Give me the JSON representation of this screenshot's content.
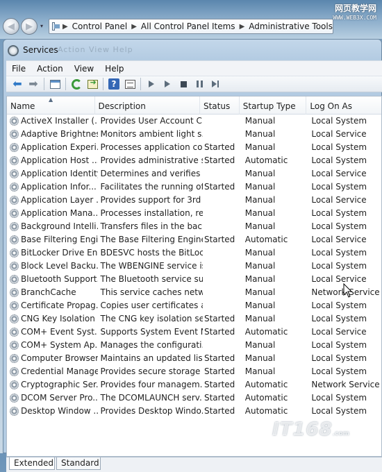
{
  "watermark": {
    "line1": "网页教学网",
    "line2": "WWW.WEB3X.COM",
    "bottom": "IT168",
    "bottom_small": ".com"
  },
  "address": {
    "crumbs": [
      "Control Panel",
      "All Control Panel Items",
      "Administrative Tools"
    ]
  },
  "window": {
    "title": "Services",
    "ghost_menu": "Action  View  Help"
  },
  "menu": [
    "File",
    "Action",
    "View",
    "Help"
  ],
  "toolbar_icons": [
    "back-arrow-icon",
    "forward-arrow-icon",
    "show-hide-tree-icon",
    "refresh-icon",
    "export-list-icon",
    "help-icon",
    "properties-icon",
    "start-service-icon",
    "start-service-alt-icon",
    "stop-service-icon",
    "pause-service-icon",
    "restart-service-icon"
  ],
  "columns": {
    "name": "Name",
    "description": "Description",
    "status": "Status",
    "startup": "Startup Type",
    "logon": "Log On As"
  },
  "services": [
    {
      "name": "ActiveX Installer (...",
      "description": "Provides User Account C...",
      "status": "",
      "startup": "Manual",
      "logon": "Local System"
    },
    {
      "name": "Adaptive Brightness",
      "description": "Monitors ambient light s...",
      "status": "",
      "startup": "Manual",
      "logon": "Local Service"
    },
    {
      "name": "Application Experi...",
      "description": "Processes application co...",
      "status": "Started",
      "startup": "Manual",
      "logon": "Local System"
    },
    {
      "name": "Application Host ...",
      "description": "Provides administrative s...",
      "status": "Started",
      "startup": "Automatic",
      "logon": "Local System"
    },
    {
      "name": "Application Identity",
      "description": "Determines and verifies t...",
      "status": "",
      "startup": "Manual",
      "logon": "Local Service"
    },
    {
      "name": "Application Infor...",
      "description": "Facilitates the running of...",
      "status": "Started",
      "startup": "Manual",
      "logon": "Local System"
    },
    {
      "name": "Application Layer ...",
      "description": "Provides support for 3rd ...",
      "status": "",
      "startup": "Manual",
      "logon": "Local Service"
    },
    {
      "name": "Application Mana...",
      "description": "Processes installation, re...",
      "status": "",
      "startup": "Manual",
      "logon": "Local System"
    },
    {
      "name": "Background Intelli...",
      "description": "Transfers files in the bac...",
      "status": "",
      "startup": "Manual",
      "logon": "Local System"
    },
    {
      "name": "Base Filtering Engi...",
      "description": "The Base Filtering Engine...",
      "status": "Started",
      "startup": "Automatic",
      "logon": "Local Service"
    },
    {
      "name": "BitLocker Drive En...",
      "description": "BDESVC hosts the BitLoc...",
      "status": "",
      "startup": "Manual",
      "logon": "Local System"
    },
    {
      "name": "Block Level Backu...",
      "description": "The WBENGINE service is...",
      "status": "",
      "startup": "Manual",
      "logon": "Local System"
    },
    {
      "name": "Bluetooth Support...",
      "description": "The Bluetooth service su...",
      "status": "",
      "startup": "Manual",
      "logon": "Local Service"
    },
    {
      "name": "BranchCache",
      "description": "This service caches netw...",
      "status": "",
      "startup": "Manual",
      "logon": "Network Service"
    },
    {
      "name": "Certificate Propag...",
      "description": "Copies user certificates a...",
      "status": "",
      "startup": "Manual",
      "logon": "Local System"
    },
    {
      "name": "CNG Key Isolation",
      "description": "The CNG key isolation se...",
      "status": "Started",
      "startup": "Manual",
      "logon": "Local System"
    },
    {
      "name": "COM+ Event Syst...",
      "description": "Supports System Event N...",
      "status": "Started",
      "startup": "Automatic",
      "logon": "Local Service"
    },
    {
      "name": "COM+ System Ap...",
      "description": "Manages the configurati...",
      "status": "",
      "startup": "Manual",
      "logon": "Local System"
    },
    {
      "name": "Computer Browser",
      "description": "Maintains an updated lis...",
      "status": "Started",
      "startup": "Manual",
      "logon": "Local System"
    },
    {
      "name": "Credential Manager",
      "description": "Provides secure storage ...",
      "status": "Started",
      "startup": "Manual",
      "logon": "Local System"
    },
    {
      "name": "Cryptographic Ser...",
      "description": "Provides four managem...",
      "status": "Started",
      "startup": "Automatic",
      "logon": "Network Service"
    },
    {
      "name": "DCOM Server Pro...",
      "description": "The DCOMLAUNCH serv...",
      "status": "Started",
      "startup": "Automatic",
      "logon": "Local System"
    },
    {
      "name": "Desktop Window ...",
      "description": "Provides Desktop Windo...",
      "status": "Started",
      "startup": "Automatic",
      "logon": "Local System"
    }
  ],
  "tabs": {
    "extended": "Extended",
    "standard": "Standard"
  }
}
